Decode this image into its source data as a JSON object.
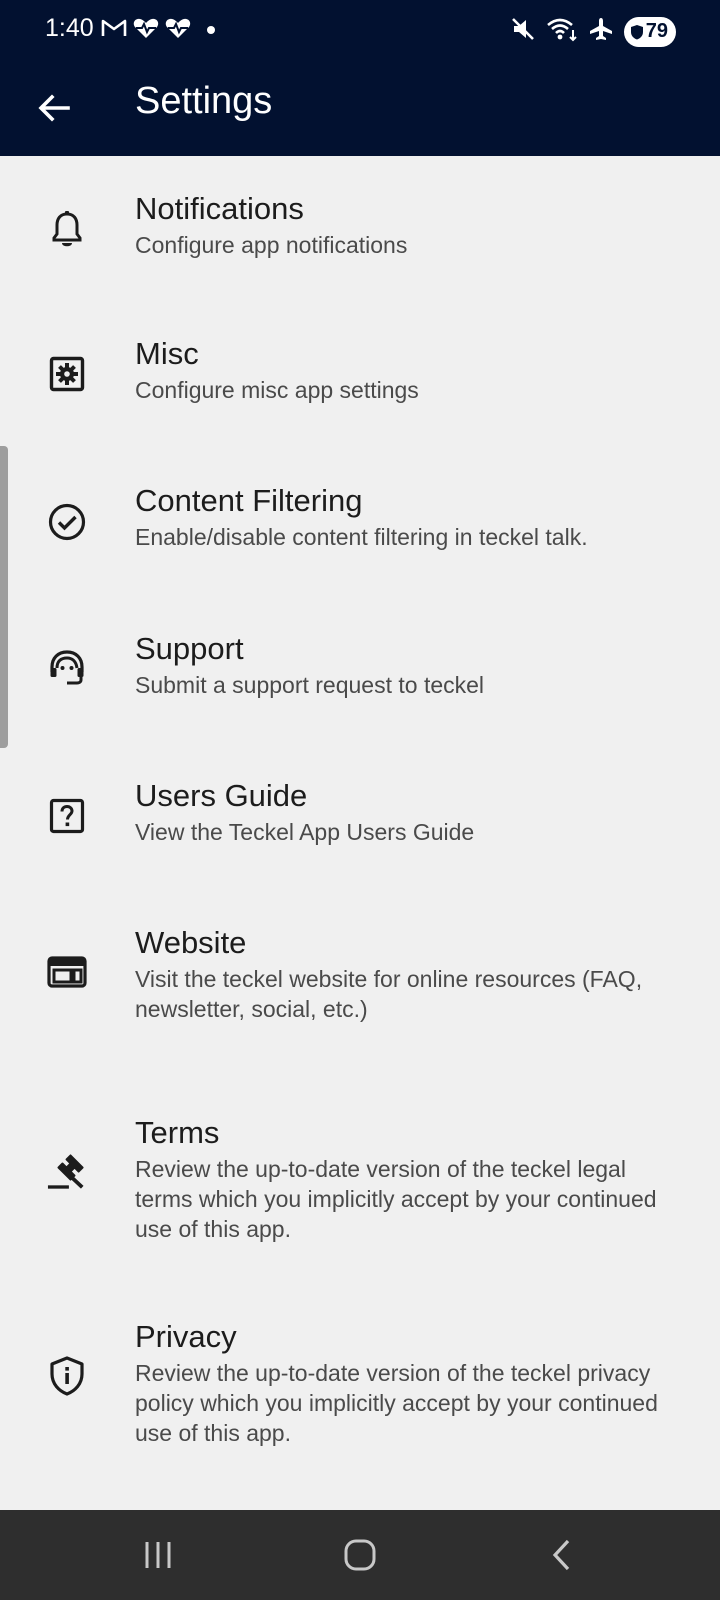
{
  "status_bar": {
    "time": "1:40",
    "battery_level": "79",
    "left_icons": [
      "gmail-icon",
      "health-icon",
      "health-icon",
      "dot-icon"
    ],
    "right_icons": [
      "mute-icon",
      "wifi-icon",
      "airplane-icon"
    ]
  },
  "app_bar": {
    "title": "Settings",
    "background": "#021130"
  },
  "settings": [
    {
      "icon": "bell-icon",
      "title": "Notifications",
      "subtitle": "Configure app notifications"
    },
    {
      "icon": "gear-box-icon",
      "title": "Misc",
      "subtitle": "Configure misc app settings"
    },
    {
      "icon": "check-circle-icon",
      "title": "Content Filtering",
      "subtitle": "Enable/disable content filtering in teckel talk."
    },
    {
      "icon": "headset-icon",
      "title": "Support",
      "subtitle": "Submit a support request to teckel"
    },
    {
      "icon": "help-box-icon",
      "title": "Users Guide",
      "subtitle": "View the Teckel App Users Guide"
    },
    {
      "icon": "web-icon",
      "title": "Website",
      "subtitle": "Visit the teckel website for online resources (FAQ, newsletter, social, etc.)"
    },
    {
      "icon": "gavel-icon",
      "title": "Terms",
      "subtitle": "Review the up-to-date version of the teckel legal terms which you implicitly accept by your continued use of this app."
    },
    {
      "icon": "shield-info-icon",
      "title": "Privacy",
      "subtitle": "Review the up-to-date version of the teckel privacy policy which you implicitly accept by your continued use of this app."
    }
  ],
  "nav_bar": {
    "buttons": [
      "recents-icon",
      "home-icon",
      "back-nav-icon"
    ]
  }
}
